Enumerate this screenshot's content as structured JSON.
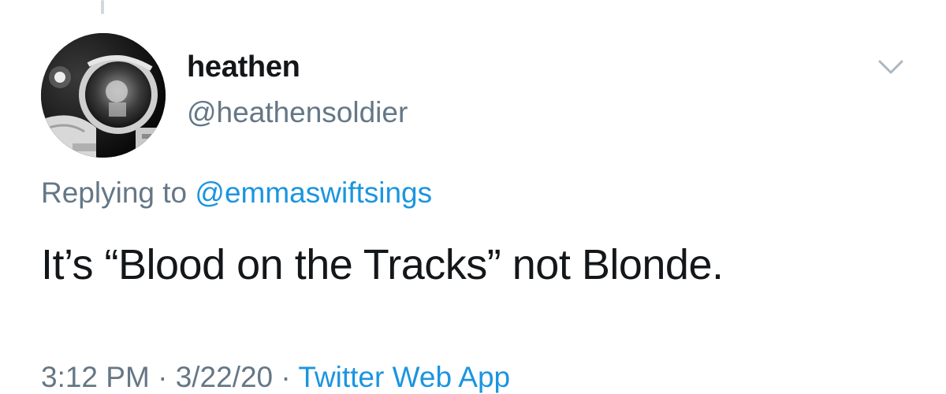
{
  "tweet": {
    "author": {
      "display_name": "heathen",
      "handle": "@heathensoldier",
      "avatar": "astronaut-selfie-avatar"
    },
    "reply": {
      "prefix": "Replying to",
      "mention": "@emmaswiftsings"
    },
    "text": "It’s “Blood on the Tracks” not Blonde.",
    "meta": {
      "time": "3:12 PM",
      "separator1": "·",
      "date": "3/22/20",
      "separator2": "·",
      "source": "Twitter Web App"
    },
    "menu_icon": "chevron-down-icon"
  },
  "colors": {
    "primary_text": "#14171a",
    "secondary_text": "#657786",
    "link": "#1b95e0",
    "chevron": "#aab8c2",
    "thread_line": "#cfd9de"
  }
}
